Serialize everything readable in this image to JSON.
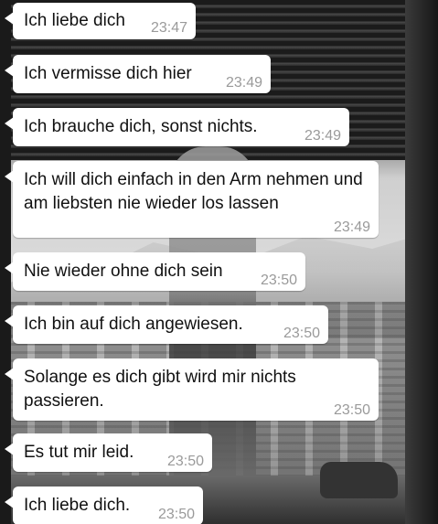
{
  "messages": [
    {
      "text": "Ich liebe dich",
      "time": "23:47"
    },
    {
      "text": "Ich vermisse dich hier",
      "time": "23:49"
    },
    {
      "text": "Ich brauche dich, sonst nichts.",
      "time": "23:49"
    },
    {
      "text": "Ich will dich einfach in den Arm nehmen und am liebsten nie wieder los lassen",
      "time": "23:49"
    },
    {
      "text": "Nie wieder ohne dich sein",
      "time": "23:50"
    },
    {
      "text": "Ich bin auf dich angewiesen.",
      "time": "23:50"
    },
    {
      "text": "Solange es dich gibt wird mir nichts passieren.",
      "time": "23:50"
    },
    {
      "text": "Es tut mir leid.",
      "time": "23:50"
    },
    {
      "text": "Ich liebe dich.",
      "time": "23:50"
    }
  ],
  "colors": {
    "bubble": "#ffffff",
    "text": "#111111",
    "timestamp": "#9a9a9a"
  },
  "wallpaper": {
    "description_icon": "photo-wallpaper"
  }
}
